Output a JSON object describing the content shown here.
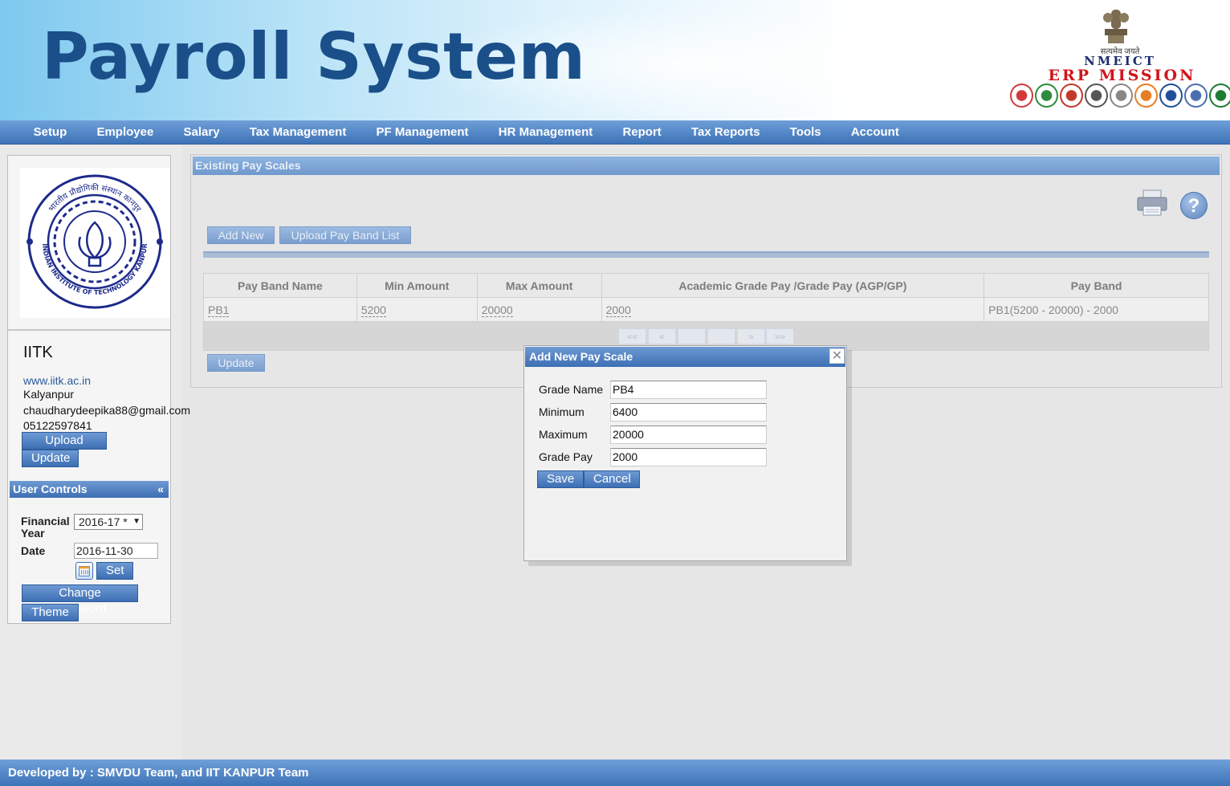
{
  "header": {
    "title": "Payroll System",
    "emblem_motto": "सत्यमेव जयते",
    "nmeict": "NMEICT",
    "erp_mission": "ERP MISSION",
    "partner_logo_colors": [
      "#d23a3a",
      "#2e8b3e",
      "#c0392b",
      "#555555",
      "#888888",
      "#e67e22",
      "#1f4f9a",
      "#4a6fb0",
      "#1e7b34"
    ]
  },
  "menu": {
    "items": [
      {
        "label": "Setup"
      },
      {
        "label": "Employee"
      },
      {
        "label": "Salary"
      },
      {
        "label": "Tax Management"
      },
      {
        "label": "PF Management"
      },
      {
        "label": "HR Management"
      },
      {
        "label": "Report"
      },
      {
        "label": "Tax Reports"
      },
      {
        "label": "Tools"
      },
      {
        "label": "Account"
      }
    ]
  },
  "profile": {
    "org_name": "IITK",
    "website": "www.iitk.ac.in",
    "address": "Kalyanpur",
    "email": "chaudharydeepika88@gmail.com",
    "phone": "05122597841",
    "upload_logo_label": "Upload Logo",
    "update_label": "Update",
    "logo_ring_text_top": "भारतीय प्रौद्योगिकी संस्थान कानपुर",
    "logo_ring_text_bottom": "INDIAN INSTITUTE OF TECHNOLOGY KANPUR",
    "logo_color": "#1d2a8c"
  },
  "user_controls": {
    "title": "User Controls",
    "collapse_symbol": "«",
    "financial_year_label": "Financial Year",
    "financial_year_value": "2016-17 *",
    "date_label": "Date",
    "date_value": "2016-11-30",
    "set_label": "Set",
    "change_password_label": "Change Password",
    "theme_label": "Theme"
  },
  "main": {
    "panel_title": "Existing Pay Scales",
    "add_new_label": "Add New",
    "upload_band_label": "Upload Pay Band List",
    "help_symbol": "?",
    "update_label": "Update",
    "columns": [
      "Pay Band Name",
      "Min Amount",
      "Max Amount",
      "Academic Grade Pay /Grade Pay (AGP/GP)",
      "Pay Band"
    ],
    "rows": [
      {
        "name": "PB1",
        "min": "5200",
        "max": "20000",
        "agp": "2000",
        "band": "PB1(5200 - 20000) - 2000"
      }
    ],
    "pager": [
      "««",
      "«",
      "",
      "",
      "»",
      "»»"
    ]
  },
  "modal": {
    "title": "Add New Pay Scale",
    "close_symbol": "✕",
    "fields": [
      {
        "label": "Grade Name",
        "value": "PB4"
      },
      {
        "label": "Minimum",
        "value": "6400"
      },
      {
        "label": "Maximum",
        "value": "20000"
      },
      {
        "label": "Grade Pay",
        "value": "2000"
      }
    ],
    "save_label": "Save",
    "cancel_label": "Cancel"
  },
  "footer": {
    "text": "Developed by : SMVDU Team, and IIT KANPUR Team"
  }
}
